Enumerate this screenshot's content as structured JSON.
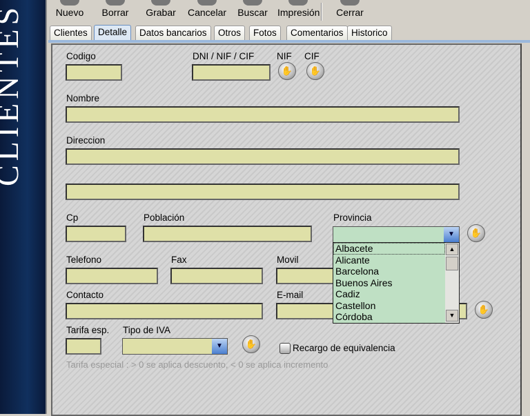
{
  "sidebar": {
    "title": "CLIENTES"
  },
  "toolbar": {
    "items": [
      "Nuevo",
      "Borrar",
      "Grabar",
      "Cancelar",
      "Buscar",
      "Impresión",
      "Cerrar"
    ]
  },
  "tabs": [
    "Clientes",
    "Detalle",
    "Datos bancarios",
    "Otros",
    "Fotos",
    "Comentarios",
    "Historico"
  ],
  "active_tab": "Detalle",
  "form": {
    "codigo": "Codigo",
    "dni": "DNI / NIF / CIF",
    "nif": "NIF",
    "cif": "CIF",
    "nombre": "Nombre",
    "direccion": "Direccion",
    "cp": "Cp",
    "poblacion": "Población",
    "provincia": "Provincia",
    "telefono": "Telefono",
    "fax": "Fax",
    "movil": "Movil",
    "contacto": "Contacto",
    "email": "E-mail",
    "tarifa": "Tarifa esp.",
    "tipo_iva": "Tipo de IVA",
    "recargo": "Recargo de equivalencia",
    "hint": "Tarifa especial : > 0 se aplica descuento, < 0 se aplica incremento"
  },
  "provincia_options": [
    "Albacete",
    "Alicante",
    "Barcelona",
    "Buenos Aires",
    "Cadiz",
    "Castellon",
    "Córdoba"
  ],
  "provincia_highlighted": "Albacete",
  "colors": {
    "field": "#dfe0a8",
    "dropdown": "#bfe0c4",
    "sidebar": "#10305e"
  }
}
